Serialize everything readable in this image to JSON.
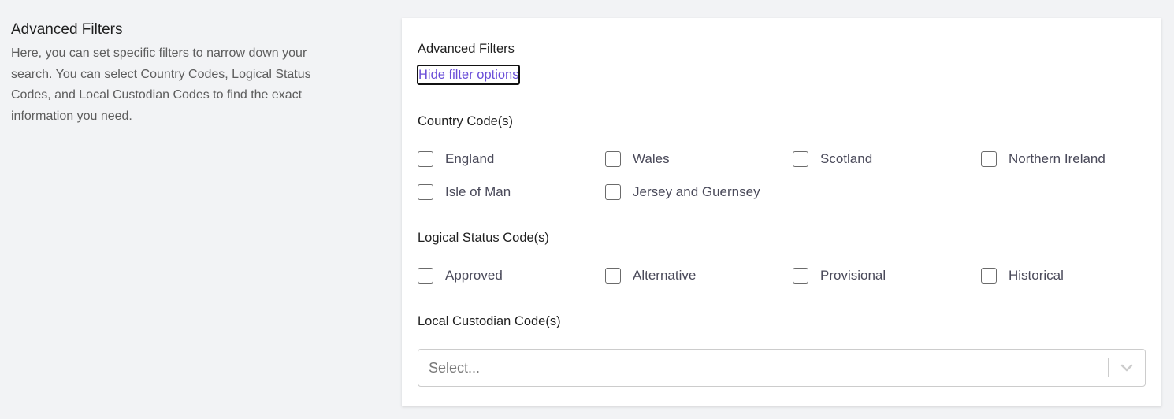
{
  "intro": {
    "title": "Advanced Filters",
    "description": "Here, you can set specific filters to narrow down your search. You can select Country Codes, Logical Status Codes, and Local Custodian Codes to find the exact information you need."
  },
  "card": {
    "title": "Advanced Filters",
    "toggle_link": "Hide filter options",
    "country": {
      "label": "Country Code(s)",
      "options": [
        {
          "label": "England",
          "checked": false
        },
        {
          "label": "Wales",
          "checked": false
        },
        {
          "label": "Scotland",
          "checked": false
        },
        {
          "label": "Northern Ireland",
          "checked": false
        },
        {
          "label": "Isle of Man",
          "checked": false
        },
        {
          "label": "Jersey and Guernsey",
          "checked": false
        }
      ]
    },
    "logical_status": {
      "label": "Logical Status Code(s)",
      "options": [
        {
          "label": "Approved",
          "checked": false
        },
        {
          "label": "Alternative",
          "checked": false
        },
        {
          "label": "Provisional",
          "checked": false
        },
        {
          "label": "Historical",
          "checked": false
        }
      ]
    },
    "local_custodian": {
      "label": "Local Custodian Code(s)",
      "placeholder": "Select...",
      "icon": "chevron-down-icon"
    }
  },
  "colors": {
    "background": "#f2f3f5",
    "card": "#ffffff",
    "link": "#6b4fd8",
    "text": "#1f1f1f",
    "muted_text": "#5d5d5d",
    "border": "#cccccc"
  }
}
